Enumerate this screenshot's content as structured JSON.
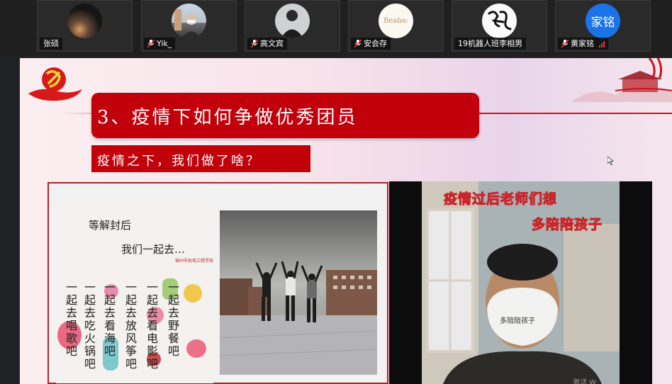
{
  "participants": [
    {
      "name": "张硕",
      "mic": false,
      "avatar": "night-sky-photo"
    },
    {
      "name": "Yik_",
      "mic": true,
      "avatar": "masked-person-photo"
    },
    {
      "name": "高文宾",
      "mic": true,
      "avatar": "person-dark-photo"
    },
    {
      "name": "安会存",
      "mic": true,
      "avatar": "logo",
      "logo_text": "Beaba:"
    },
    {
      "name": "19机器人班李相男",
      "mic": false,
      "avatar": "calligraphy-logo"
    },
    {
      "name": "黄家铭",
      "mic": true,
      "avatar": "text",
      "avatar_text": "家铭",
      "avatar_color": "#1a73e8",
      "signal": true
    }
  ],
  "slide": {
    "title": "3、疫情下如何争做优秀团员",
    "subtitle": "疫情之下，我们做了啥？",
    "accent_color": "#c1000b",
    "left_photo": {
      "paper_line1": "等解封后",
      "paper_line2": "我们一起去…",
      "paper_stamp": "锦州市机电工程学校",
      "columns": [
        "一起去唱歌吧",
        "一起去吃火锅吧",
        "一起去看海吧",
        "一起去放风筝吧",
        "一起去看电影吧",
        "一起去野餐吧"
      ]
    },
    "video": {
      "caption_line1": "疫情过后老师们想",
      "caption_line2": "多陪陪孩子",
      "mask_text": "多陪陪孩子",
      "watermark": "激活 W"
    }
  }
}
